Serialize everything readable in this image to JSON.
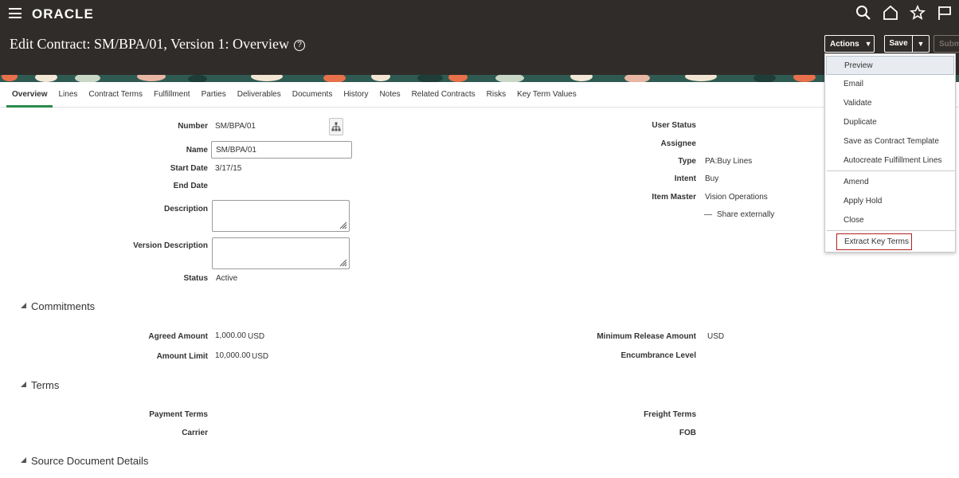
{
  "brand": "ORACLE",
  "page_title": "Edit Contract: SM/BPA/01, Version 1: Overview",
  "help_symbol": "?",
  "header_buttons": {
    "actions": "Actions",
    "save": "Save",
    "submit": "Subm"
  },
  "global_icons": [
    "search-icon",
    "home-icon",
    "star-icon",
    "flag-icon"
  ],
  "tabs": [
    "Overview",
    "Lines",
    "Contract Terms",
    "Fulfillment",
    "Parties",
    "Deliverables",
    "Documents",
    "History",
    "Notes",
    "Related Contracts",
    "Risks",
    "Key Term Values"
  ],
  "active_tab": "Overview",
  "overview": {
    "number_label": "Number",
    "number_value": "SM/BPA/01",
    "name_label": "Name",
    "name_value": "SM/BPA/01",
    "start_date_label": "Start Date",
    "start_date_value": "3/17/15",
    "end_date_label": "End Date",
    "description_label": "Description",
    "version_description_label": "Version Description",
    "status_label": "Status",
    "status_value": "Active",
    "user_status_label": "User Status",
    "assignee_label": "Assignee",
    "type_label": "Type",
    "type_value": "PA:Buy Lines",
    "intent_label": "Intent",
    "intent_value": "Buy",
    "item_master_label": "Item Master",
    "item_master_value": "Vision Operations",
    "share_externally": "Share externally"
  },
  "commitments": {
    "title": "Commitments",
    "agreed_amount_label": "Agreed Amount",
    "agreed_amount_value": "1,000.00",
    "agreed_amount_currency": "USD",
    "amount_limit_label": "Amount Limit",
    "amount_limit_value": "10,000.00",
    "amount_limit_currency": "USD",
    "min_release_label": "Minimum Release Amount",
    "min_release_currency": "USD",
    "encumbrance_label": "Encumbrance Level"
  },
  "terms": {
    "title": "Terms",
    "payment_terms_label": "Payment Terms",
    "carrier_label": "Carrier",
    "freight_terms_label": "Freight Terms",
    "fob_label": "FOB"
  },
  "source_document": {
    "title": "Source Document Details"
  },
  "actions_menu": [
    "Preview",
    "Email",
    "Validate",
    "Duplicate",
    "Save as Contract Template",
    "Autocreate Fulfillment Lines",
    "Amend",
    "Apply Hold",
    "Close",
    "Extract Key Terms"
  ],
  "colors": {
    "header_bg": "#302c29",
    "active_tab_underline": "#2a8a4b",
    "highlight_border": "#b02020"
  }
}
